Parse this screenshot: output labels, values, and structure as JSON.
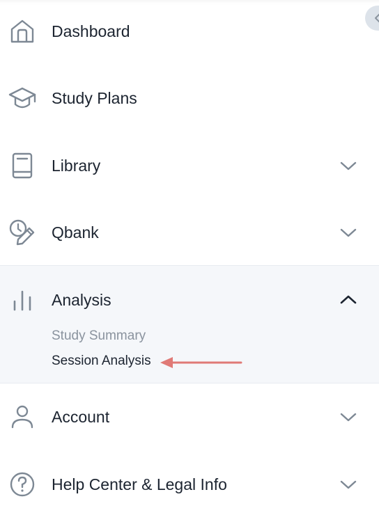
{
  "sidebar": {
    "items": [
      {
        "label": "Dashboard",
        "icon": "home-icon"
      },
      {
        "label": "Study Plans",
        "icon": "graduation-cap-icon"
      },
      {
        "label": "Library",
        "icon": "book-icon",
        "expandable": true
      },
      {
        "label": "Qbank",
        "icon": "qbank-pencil-icon",
        "expandable": true
      },
      {
        "label": "Analysis",
        "icon": "bar-chart-icon",
        "expandable": true,
        "expanded": true,
        "children": [
          {
            "label": "Study Summary"
          },
          {
            "label": "Session Analysis"
          }
        ]
      },
      {
        "label": "Account",
        "icon": "user-icon",
        "expandable": true
      },
      {
        "label": "Help Center & Legal Info",
        "icon": "help-icon",
        "expandable": true
      }
    ]
  },
  "colors": {
    "text": "#1c2430",
    "icon": "#7d8894",
    "muted": "#8a939e",
    "expanded_bg": "#f5f7fa",
    "annotation_arrow": "#e07a76"
  }
}
